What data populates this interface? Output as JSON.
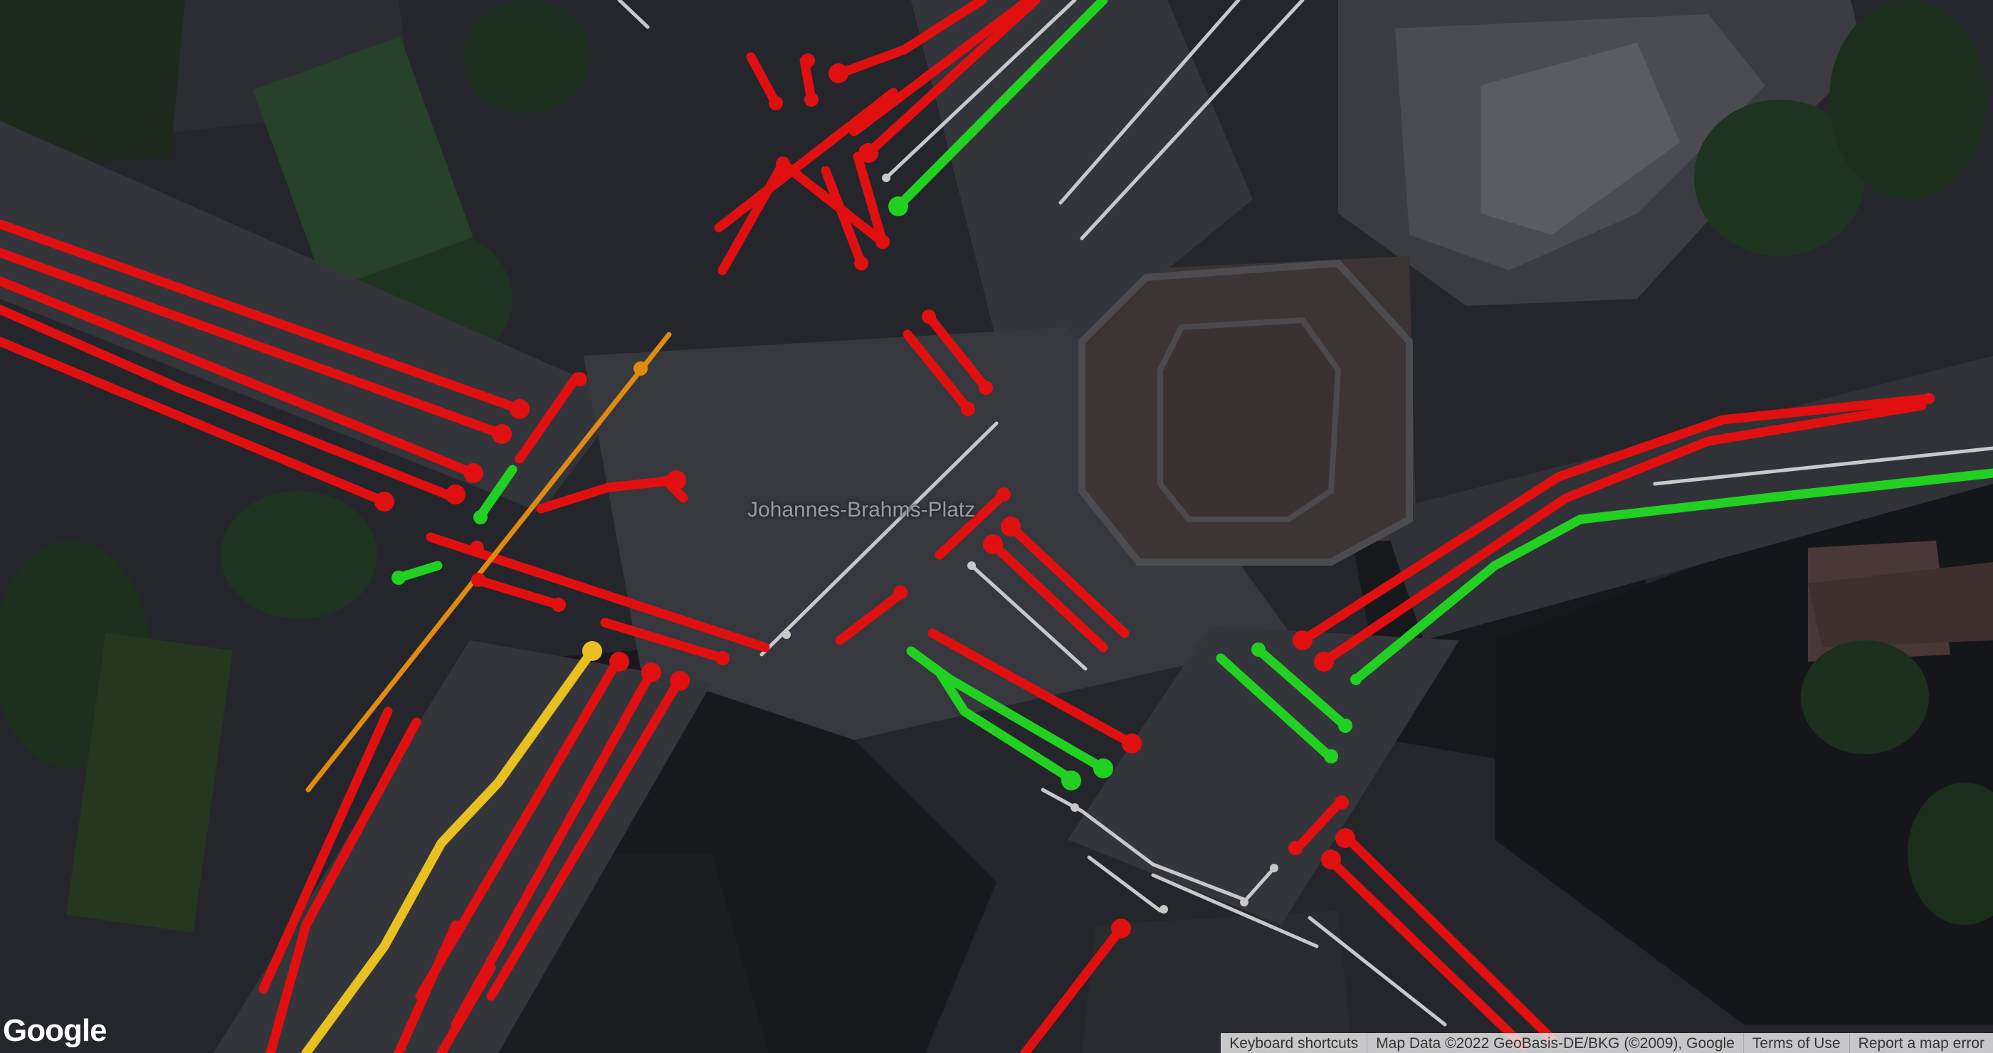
{
  "map": {
    "place_label": "Johannes-Brahms-Platz",
    "view": "satellite",
    "overlay": "traffic signal phase lanes",
    "lane_colors": {
      "red": "#e01010",
      "green": "#22d022",
      "yellow": "#e8c020",
      "orange": "#e08a10",
      "inactive": "#c8c8c8"
    }
  },
  "branding": {
    "logo": "Google"
  },
  "attribution": {
    "keyboard_shortcuts": "Keyboard shortcuts",
    "map_data": "Map Data ©2022 GeoBasis-DE/BKG (©2009), Google",
    "terms": "Terms of Use",
    "report": "Report a map error"
  }
}
